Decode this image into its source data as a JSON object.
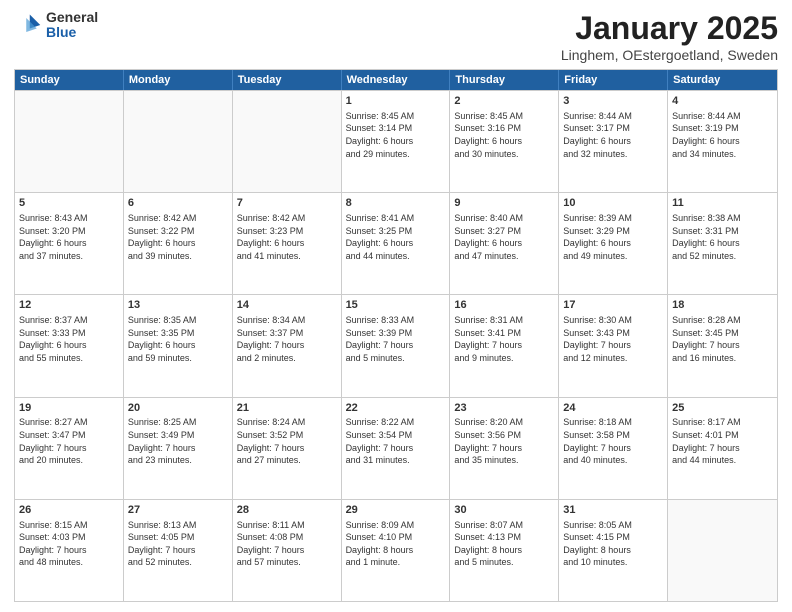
{
  "logo": {
    "general": "General",
    "blue": "Blue"
  },
  "title": "January 2025",
  "location": "Linghem, OEstergoetland, Sweden",
  "header_days": [
    "Sunday",
    "Monday",
    "Tuesday",
    "Wednesday",
    "Thursday",
    "Friday",
    "Saturday"
  ],
  "weeks": [
    [
      {
        "day": "",
        "info": ""
      },
      {
        "day": "",
        "info": ""
      },
      {
        "day": "",
        "info": ""
      },
      {
        "day": "1",
        "info": "Sunrise: 8:45 AM\nSunset: 3:14 PM\nDaylight: 6 hours\nand 29 minutes."
      },
      {
        "day": "2",
        "info": "Sunrise: 8:45 AM\nSunset: 3:16 PM\nDaylight: 6 hours\nand 30 minutes."
      },
      {
        "day": "3",
        "info": "Sunrise: 8:44 AM\nSunset: 3:17 PM\nDaylight: 6 hours\nand 32 minutes."
      },
      {
        "day": "4",
        "info": "Sunrise: 8:44 AM\nSunset: 3:19 PM\nDaylight: 6 hours\nand 34 minutes."
      }
    ],
    [
      {
        "day": "5",
        "info": "Sunrise: 8:43 AM\nSunset: 3:20 PM\nDaylight: 6 hours\nand 37 minutes."
      },
      {
        "day": "6",
        "info": "Sunrise: 8:42 AM\nSunset: 3:22 PM\nDaylight: 6 hours\nand 39 minutes."
      },
      {
        "day": "7",
        "info": "Sunrise: 8:42 AM\nSunset: 3:23 PM\nDaylight: 6 hours\nand 41 minutes."
      },
      {
        "day": "8",
        "info": "Sunrise: 8:41 AM\nSunset: 3:25 PM\nDaylight: 6 hours\nand 44 minutes."
      },
      {
        "day": "9",
        "info": "Sunrise: 8:40 AM\nSunset: 3:27 PM\nDaylight: 6 hours\nand 47 minutes."
      },
      {
        "day": "10",
        "info": "Sunrise: 8:39 AM\nSunset: 3:29 PM\nDaylight: 6 hours\nand 49 minutes."
      },
      {
        "day": "11",
        "info": "Sunrise: 8:38 AM\nSunset: 3:31 PM\nDaylight: 6 hours\nand 52 minutes."
      }
    ],
    [
      {
        "day": "12",
        "info": "Sunrise: 8:37 AM\nSunset: 3:33 PM\nDaylight: 6 hours\nand 55 minutes."
      },
      {
        "day": "13",
        "info": "Sunrise: 8:35 AM\nSunset: 3:35 PM\nDaylight: 6 hours\nand 59 minutes."
      },
      {
        "day": "14",
        "info": "Sunrise: 8:34 AM\nSunset: 3:37 PM\nDaylight: 7 hours\nand 2 minutes."
      },
      {
        "day": "15",
        "info": "Sunrise: 8:33 AM\nSunset: 3:39 PM\nDaylight: 7 hours\nand 5 minutes."
      },
      {
        "day": "16",
        "info": "Sunrise: 8:31 AM\nSunset: 3:41 PM\nDaylight: 7 hours\nand 9 minutes."
      },
      {
        "day": "17",
        "info": "Sunrise: 8:30 AM\nSunset: 3:43 PM\nDaylight: 7 hours\nand 12 minutes."
      },
      {
        "day": "18",
        "info": "Sunrise: 8:28 AM\nSunset: 3:45 PM\nDaylight: 7 hours\nand 16 minutes."
      }
    ],
    [
      {
        "day": "19",
        "info": "Sunrise: 8:27 AM\nSunset: 3:47 PM\nDaylight: 7 hours\nand 20 minutes."
      },
      {
        "day": "20",
        "info": "Sunrise: 8:25 AM\nSunset: 3:49 PM\nDaylight: 7 hours\nand 23 minutes."
      },
      {
        "day": "21",
        "info": "Sunrise: 8:24 AM\nSunset: 3:52 PM\nDaylight: 7 hours\nand 27 minutes."
      },
      {
        "day": "22",
        "info": "Sunrise: 8:22 AM\nSunset: 3:54 PM\nDaylight: 7 hours\nand 31 minutes."
      },
      {
        "day": "23",
        "info": "Sunrise: 8:20 AM\nSunset: 3:56 PM\nDaylight: 7 hours\nand 35 minutes."
      },
      {
        "day": "24",
        "info": "Sunrise: 8:18 AM\nSunset: 3:58 PM\nDaylight: 7 hours\nand 40 minutes."
      },
      {
        "day": "25",
        "info": "Sunrise: 8:17 AM\nSunset: 4:01 PM\nDaylight: 7 hours\nand 44 minutes."
      }
    ],
    [
      {
        "day": "26",
        "info": "Sunrise: 8:15 AM\nSunset: 4:03 PM\nDaylight: 7 hours\nand 48 minutes."
      },
      {
        "day": "27",
        "info": "Sunrise: 8:13 AM\nSunset: 4:05 PM\nDaylight: 7 hours\nand 52 minutes."
      },
      {
        "day": "28",
        "info": "Sunrise: 8:11 AM\nSunset: 4:08 PM\nDaylight: 7 hours\nand 57 minutes."
      },
      {
        "day": "29",
        "info": "Sunrise: 8:09 AM\nSunset: 4:10 PM\nDaylight: 8 hours\nand 1 minute."
      },
      {
        "day": "30",
        "info": "Sunrise: 8:07 AM\nSunset: 4:13 PM\nDaylight: 8 hours\nand 5 minutes."
      },
      {
        "day": "31",
        "info": "Sunrise: 8:05 AM\nSunset: 4:15 PM\nDaylight: 8 hours\nand 10 minutes."
      },
      {
        "day": "",
        "info": ""
      }
    ]
  ]
}
